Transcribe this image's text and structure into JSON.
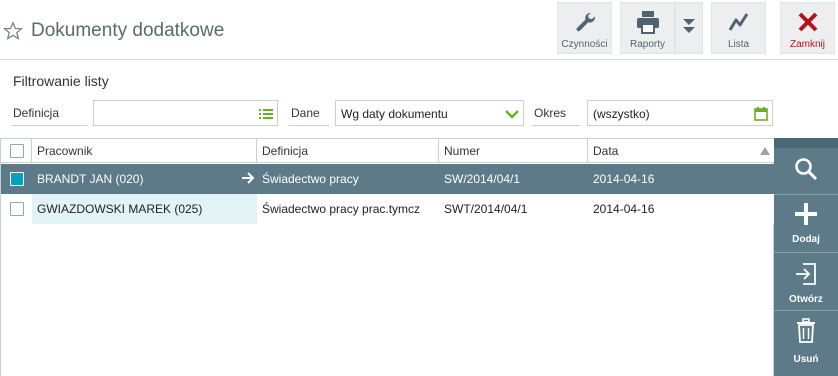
{
  "header": {
    "title": "Dokumenty dodatkowe",
    "toolbar": {
      "czynnosci_label": "Czynności",
      "raporty_label": "Raporty",
      "lista_label": "Lista",
      "zamknij_label": "Zamknij"
    }
  },
  "filter": {
    "title": "Filtrowanie listy",
    "definicja_label": "Definicja",
    "definicja_value": "",
    "dane_label": "Dane",
    "dane_value": "Wg daty dokumentu",
    "okres_label": "Okres",
    "okres_value": "(wszystko)"
  },
  "grid": {
    "columns": [
      "Pracownik",
      "Definicja",
      "Numer",
      "Data"
    ],
    "rows": [
      {
        "pracownik": "BRANDT JAN (020)",
        "definicja": "Świadectwo pracy",
        "numer": "SW/2014/04/1",
        "data": "2014-04-16"
      },
      {
        "pracownik": "GWIAZDOWSKI MAREK (025)",
        "definicja": "Świadectwo pracy prac.tymcz",
        "numer": "SWT/2014/04/1",
        "data": "2014-04-16"
      }
    ]
  },
  "side": {
    "dodaj_label": "Dodaj",
    "otworz_label": "Otwórz",
    "usun_label": "Usuń"
  },
  "colors": {
    "accent": "#5c7a87",
    "close_red": "#b2141c",
    "green": "#6ab023",
    "selected_check": "#00a3c4"
  },
  "icons": [
    "star-icon",
    "wrench-icon",
    "printer-icon",
    "double-chevron-down-icon",
    "chart-icon",
    "close-icon",
    "list-icon",
    "chevron-down-icon",
    "calendar-icon",
    "arrow-right-icon",
    "search-icon",
    "plus-icon",
    "open-icon",
    "trash-icon"
  ]
}
